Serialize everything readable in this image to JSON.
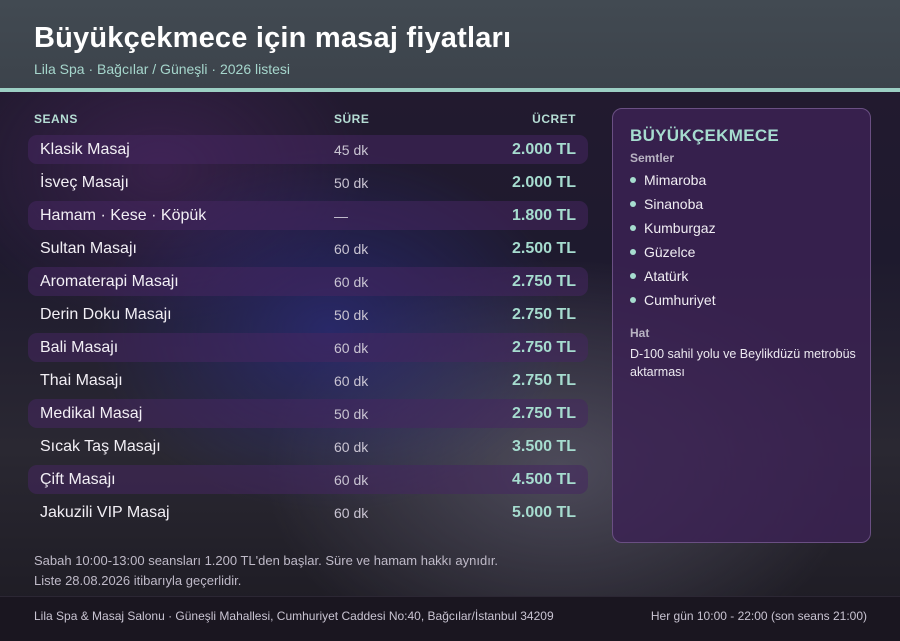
{
  "header": {
    "title": "Büyükçekmece için masaj fiyatları",
    "subtitle": "Lila Spa · Bağcılar / Güneşli · 2026 listesi"
  },
  "table": {
    "columns": [
      "SEANS",
      "SÜRE",
      "ÜCRET"
    ],
    "rows": [
      {
        "name": "Klasik Masaj",
        "duration": "45 dk",
        "price": "2.000 TL"
      },
      {
        "name": "İsveç Masajı",
        "duration": "50 dk",
        "price": "2.000 TL"
      },
      {
        "name": "Hamam · Kese · Köpük",
        "duration": "—",
        "price": "1.800 TL"
      },
      {
        "name": "Sultan Masajı",
        "duration": "60 dk",
        "price": "2.500 TL"
      },
      {
        "name": "Aromaterapi Masajı",
        "duration": "60 dk",
        "price": "2.750 TL"
      },
      {
        "name": "Derin Doku Masajı",
        "duration": "50 dk",
        "price": "2.750 TL"
      },
      {
        "name": "Bali Masajı",
        "duration": "60 dk",
        "price": "2.750 TL"
      },
      {
        "name": "Thai Masajı",
        "duration": "60 dk",
        "price": "2.750 TL"
      },
      {
        "name": "Medikal Masaj",
        "duration": "50 dk",
        "price": "2.750 TL"
      },
      {
        "name": "Sıcak Taş Masajı",
        "duration": "60 dk",
        "price": "3.500 TL"
      },
      {
        "name": "Çift Masajı",
        "duration": "60 dk",
        "price": "4.500 TL"
      },
      {
        "name": "Jakuzili VIP Masaj",
        "duration": "60 dk",
        "price": "5.000 TL"
      }
    ]
  },
  "panel": {
    "title": "BÜYÜKÇEKMECE",
    "districts_label": "Semtler",
    "districts": [
      "Mimaroba",
      "Sinanoba",
      "Kumburgaz",
      "Güzelce",
      "Atatürk",
      "Cumhuriyet"
    ],
    "route_label": "Hat",
    "route": "D-100 sahil yolu ve Beylikdüzü metrobüs aktarması"
  },
  "notes": {
    "line1": "Sabah 10:00-13:00 seansları 1.200 TL'den başlar. Süre ve hamam hakkı aynıdır.",
    "line2": "Liste 28.08.2026 itibarıyla geçerlidir."
  },
  "footer": {
    "address": "Lila Spa & Masaj Salonu · Güneşli Mahallesi, Cumhuriyet Caddesi No:40, Bağcılar/İstanbul 34209",
    "hours": "Her gün 10:00 - 22:00 (son seans 21:00)"
  },
  "colors": {
    "accent": "#a6dccf",
    "header_bg": "#3f464e",
    "header_rule": "#9ccfc4",
    "row_band": "#462660",
    "panel_bg": "#3c2254"
  }
}
